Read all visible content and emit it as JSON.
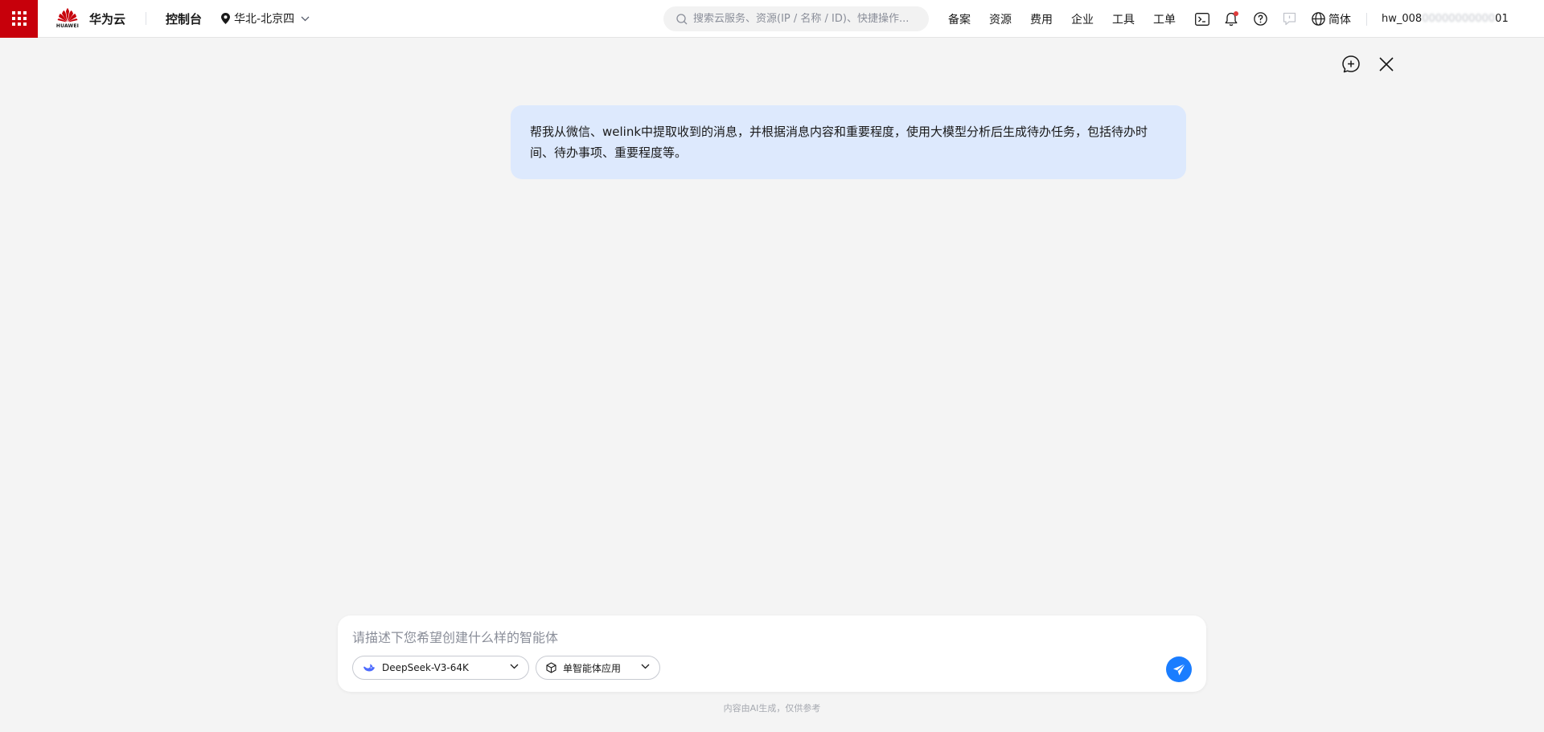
{
  "header": {
    "brand": "华为云",
    "logo_text": "HUAWEI",
    "console": "控制台",
    "region": "华北-北京四",
    "search_placeholder": "搜索云服务、资源(IP / 名称 / ID)、快捷操作...",
    "nav": [
      "备案",
      "资源",
      "费用",
      "企业",
      "工具",
      "工单"
    ],
    "language": "简体",
    "user_prefix": "hw_008",
    "user_masked": "00000000000",
    "user_suffix": "01",
    "accent_color": "#c7000b"
  },
  "chat": {
    "user_message": "帮我从微信、welink中提取收到的消息，并根据消息内容和重要程度，使用大模型分析后生成待办任务，包括待办时间、待办事项、重要程度等。"
  },
  "composer": {
    "placeholder": "请描述下您希望创建什么样的智能体",
    "model": "DeepSeek-V3-64K",
    "agent_type": "单智能体应用",
    "send_color": "#1a7dff"
  },
  "disclaimer": "内容由AI生成，仅供参考"
}
